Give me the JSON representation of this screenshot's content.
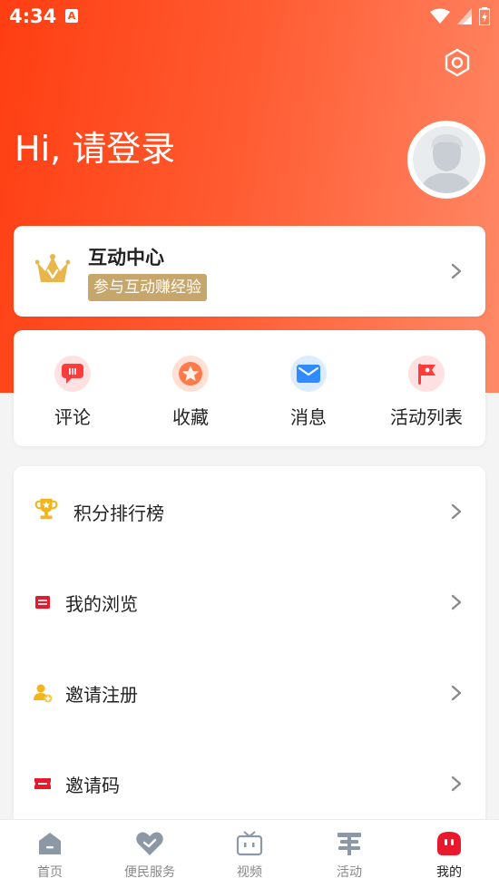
{
  "status_bar": {
    "time": "4:34",
    "notif_glyph": "A"
  },
  "header": {
    "greeting": "Hi, 请登录"
  },
  "interact": {
    "title": "互动中心",
    "badge": "参与互动赚经验"
  },
  "quick_actions": [
    {
      "label": "评论",
      "icon": "comment-icon",
      "color": "#ff3b3b"
    },
    {
      "label": "收藏",
      "icon": "star-icon",
      "color": "#ff6a3d"
    },
    {
      "label": "消息",
      "icon": "mail-icon",
      "color": "#2f8bff"
    },
    {
      "label": "活动列表",
      "icon": "flag-icon",
      "color": "#ff3b3b"
    }
  ],
  "menu": [
    {
      "label": "积分排行榜",
      "icon": "trophy-icon"
    },
    {
      "label": "我的浏览",
      "icon": "history-icon"
    },
    {
      "label": "邀请注册",
      "icon": "invite-user-icon"
    },
    {
      "label": "邀请码",
      "icon": "ticket-icon"
    }
  ],
  "tabs": [
    {
      "label": "首页",
      "icon": "home-icon"
    },
    {
      "label": "便民服务",
      "icon": "heart-icon"
    },
    {
      "label": "视频",
      "icon": "tv-icon"
    },
    {
      "label": "活动",
      "icon": "activity-icon"
    },
    {
      "label": "我的",
      "icon": "profile-icon"
    }
  ],
  "colors": {
    "brand": "#ff3e12",
    "gold": "#c7a66c",
    "active_tab": "#e8192c"
  }
}
